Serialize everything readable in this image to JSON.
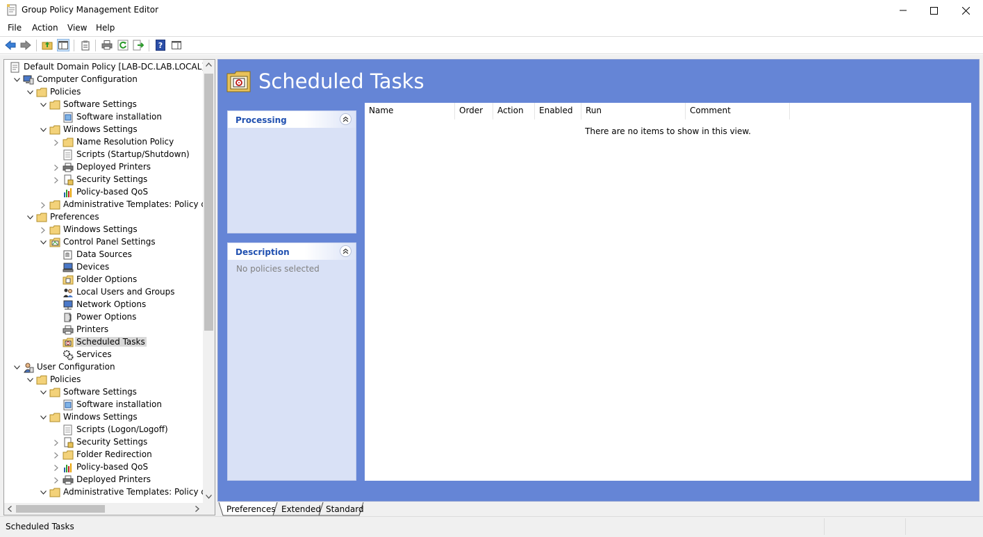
{
  "window": {
    "title": "Group Policy Management Editor"
  },
  "menu": [
    "File",
    "Action",
    "View",
    "Help"
  ],
  "toolbar": {
    "buttons": [
      "back-icon",
      "forward-icon",
      "up-folder-icon",
      "show-hide-console-tree-icon",
      "properties-icon",
      "print-icon",
      "refresh-icon",
      "export-list-icon",
      "help-icon",
      "show-hide-action-pane-icon"
    ]
  },
  "tree": {
    "items": [
      {
        "label": "Default Domain Policy [LAB-DC.LAB.LOCAL] Poli",
        "expander": "none",
        "icon": "policy-doc-icon"
      },
      {
        "label": "Computer Configuration",
        "expander": "expanded",
        "icon": "computer-config-icon"
      },
      {
        "label": "Policies",
        "expander": "expanded",
        "icon": "folder-icon"
      },
      {
        "label": "Software Settings",
        "expander": "expanded",
        "icon": "folder-icon"
      },
      {
        "label": "Software installation",
        "expander": "none",
        "icon": "software-install-icon"
      },
      {
        "label": "Windows Settings",
        "expander": "expanded",
        "icon": "folder-icon"
      },
      {
        "label": "Name Resolution Policy",
        "expander": "collapsed",
        "icon": "folder-icon"
      },
      {
        "label": "Scripts (Startup/Shutdown)",
        "expander": "none",
        "icon": "script-icon"
      },
      {
        "label": "Deployed Printers",
        "expander": "collapsed",
        "icon": "printer-icon"
      },
      {
        "label": "Security Settings",
        "expander": "collapsed",
        "icon": "security-icon"
      },
      {
        "label": "Policy-based QoS",
        "expander": "none",
        "icon": "qos-chart-icon"
      },
      {
        "label": "Administrative Templates: Policy defin",
        "expander": "collapsed",
        "icon": "folder-icon"
      },
      {
        "label": "Preferences",
        "expander": "expanded",
        "icon": "folder-icon"
      },
      {
        "label": "Windows Settings",
        "expander": "collapsed",
        "icon": "folder-icon"
      },
      {
        "label": "Control Panel Settings",
        "expander": "expanded",
        "icon": "control-panel-icon"
      },
      {
        "label": "Data Sources",
        "expander": "none",
        "icon": "data-sources-icon"
      },
      {
        "label": "Devices",
        "expander": "none",
        "icon": "devices-icon"
      },
      {
        "label": "Folder Options",
        "expander": "none",
        "icon": "folder-options-icon"
      },
      {
        "label": "Local Users and Groups",
        "expander": "none",
        "icon": "users-groups-icon"
      },
      {
        "label": "Network Options",
        "expander": "none",
        "icon": "network-options-icon"
      },
      {
        "label": "Power Options",
        "expander": "none",
        "icon": "power-options-icon"
      },
      {
        "label": "Printers",
        "expander": "none",
        "icon": "printers-icon"
      },
      {
        "label": "Scheduled Tasks",
        "expander": "none",
        "icon": "scheduled-tasks-icon",
        "selected": true
      },
      {
        "label": "Services",
        "expander": "none",
        "icon": "services-gear-icon"
      },
      {
        "label": "User Configuration",
        "expander": "expanded",
        "icon": "user-config-icon"
      },
      {
        "label": "Policies",
        "expander": "expanded",
        "icon": "folder-icon"
      },
      {
        "label": "Software Settings",
        "expander": "expanded",
        "icon": "folder-icon"
      },
      {
        "label": "Software installation",
        "expander": "none",
        "icon": "software-install-icon"
      },
      {
        "label": "Windows Settings",
        "expander": "expanded",
        "icon": "folder-icon"
      },
      {
        "label": "Scripts (Logon/Logoff)",
        "expander": "none",
        "icon": "script-icon"
      },
      {
        "label": "Security Settings",
        "expander": "collapsed",
        "icon": "security-icon"
      },
      {
        "label": "Folder Redirection",
        "expander": "collapsed",
        "icon": "folder-icon"
      },
      {
        "label": "Policy-based QoS",
        "expander": "collapsed",
        "icon": "qos-chart-icon"
      },
      {
        "label": "Deployed Printers",
        "expander": "collapsed",
        "icon": "printer-icon"
      },
      {
        "label": "Administrative Templates: Policy defin",
        "expander": "expanded",
        "icon": "folder-icon"
      }
    ]
  },
  "content": {
    "title": "Scheduled Tasks",
    "processing_panel": {
      "title": "Processing"
    },
    "description_panel": {
      "title": "Description",
      "text": "No policies selected"
    },
    "columns": [
      "Name",
      "Order",
      "Action",
      "Enabled",
      "Run",
      "Comment"
    ],
    "empty_message": "There are no items to show in this view."
  },
  "tabs": [
    "Preferences",
    "Extended",
    "Standard"
  ],
  "status": {
    "text": "Scheduled Tasks"
  },
  "colors": {
    "content_background": "#6585d6",
    "panel_background": "#d9e1f6",
    "panel_title": "#2050b0",
    "selection": "#d9d9d9"
  }
}
